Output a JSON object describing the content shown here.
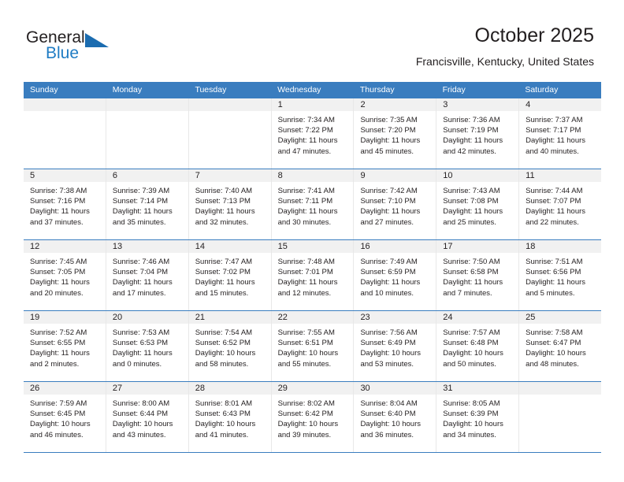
{
  "brand": {
    "name_part1": "General",
    "name_part2": "Blue",
    "accent_color": "#1b6cb0"
  },
  "header": {
    "title": "October 2025",
    "location": "Francisville, Kentucky, United States"
  },
  "theme": {
    "header_row_color": "#3a7dbf",
    "day_band_color": "#f1f1f1",
    "row_separator_color": "#3a7dbf",
    "text_color": "#231f20"
  },
  "weekdays": [
    "Sunday",
    "Monday",
    "Tuesday",
    "Wednesday",
    "Thursday",
    "Friday",
    "Saturday"
  ],
  "labels": {
    "sunrise_prefix": "Sunrise:",
    "sunset_prefix": "Sunset:",
    "daylight_prefix": "Daylight:"
  },
  "weeks": [
    [
      {
        "day": "",
        "empty": true
      },
      {
        "day": "",
        "empty": true
      },
      {
        "day": "",
        "empty": true
      },
      {
        "day": "1",
        "sunrise": "Sunrise: 7:34 AM",
        "sunset": "Sunset: 7:22 PM",
        "daylight": "Daylight: 11 hours and 47 minutes."
      },
      {
        "day": "2",
        "sunrise": "Sunrise: 7:35 AM",
        "sunset": "Sunset: 7:20 PM",
        "daylight": "Daylight: 11 hours and 45 minutes."
      },
      {
        "day": "3",
        "sunrise": "Sunrise: 7:36 AM",
        "sunset": "Sunset: 7:19 PM",
        "daylight": "Daylight: 11 hours and 42 minutes."
      },
      {
        "day": "4",
        "sunrise": "Sunrise: 7:37 AM",
        "sunset": "Sunset: 7:17 PM",
        "daylight": "Daylight: 11 hours and 40 minutes."
      }
    ],
    [
      {
        "day": "5",
        "sunrise": "Sunrise: 7:38 AM",
        "sunset": "Sunset: 7:16 PM",
        "daylight": "Daylight: 11 hours and 37 minutes."
      },
      {
        "day": "6",
        "sunrise": "Sunrise: 7:39 AM",
        "sunset": "Sunset: 7:14 PM",
        "daylight": "Daylight: 11 hours and 35 minutes."
      },
      {
        "day": "7",
        "sunrise": "Sunrise: 7:40 AM",
        "sunset": "Sunset: 7:13 PM",
        "daylight": "Daylight: 11 hours and 32 minutes."
      },
      {
        "day": "8",
        "sunrise": "Sunrise: 7:41 AM",
        "sunset": "Sunset: 7:11 PM",
        "daylight": "Daylight: 11 hours and 30 minutes."
      },
      {
        "day": "9",
        "sunrise": "Sunrise: 7:42 AM",
        "sunset": "Sunset: 7:10 PM",
        "daylight": "Daylight: 11 hours and 27 minutes."
      },
      {
        "day": "10",
        "sunrise": "Sunrise: 7:43 AM",
        "sunset": "Sunset: 7:08 PM",
        "daylight": "Daylight: 11 hours and 25 minutes."
      },
      {
        "day": "11",
        "sunrise": "Sunrise: 7:44 AM",
        "sunset": "Sunset: 7:07 PM",
        "daylight": "Daylight: 11 hours and 22 minutes."
      }
    ],
    [
      {
        "day": "12",
        "sunrise": "Sunrise: 7:45 AM",
        "sunset": "Sunset: 7:05 PM",
        "daylight": "Daylight: 11 hours and 20 minutes."
      },
      {
        "day": "13",
        "sunrise": "Sunrise: 7:46 AM",
        "sunset": "Sunset: 7:04 PM",
        "daylight": "Daylight: 11 hours and 17 minutes."
      },
      {
        "day": "14",
        "sunrise": "Sunrise: 7:47 AM",
        "sunset": "Sunset: 7:02 PM",
        "daylight": "Daylight: 11 hours and 15 minutes."
      },
      {
        "day": "15",
        "sunrise": "Sunrise: 7:48 AM",
        "sunset": "Sunset: 7:01 PM",
        "daylight": "Daylight: 11 hours and 12 minutes."
      },
      {
        "day": "16",
        "sunrise": "Sunrise: 7:49 AM",
        "sunset": "Sunset: 6:59 PM",
        "daylight": "Daylight: 11 hours and 10 minutes."
      },
      {
        "day": "17",
        "sunrise": "Sunrise: 7:50 AM",
        "sunset": "Sunset: 6:58 PM",
        "daylight": "Daylight: 11 hours and 7 minutes."
      },
      {
        "day": "18",
        "sunrise": "Sunrise: 7:51 AM",
        "sunset": "Sunset: 6:56 PM",
        "daylight": "Daylight: 11 hours and 5 minutes."
      }
    ],
    [
      {
        "day": "19",
        "sunrise": "Sunrise: 7:52 AM",
        "sunset": "Sunset: 6:55 PM",
        "daylight": "Daylight: 11 hours and 2 minutes."
      },
      {
        "day": "20",
        "sunrise": "Sunrise: 7:53 AM",
        "sunset": "Sunset: 6:53 PM",
        "daylight": "Daylight: 11 hours and 0 minutes."
      },
      {
        "day": "21",
        "sunrise": "Sunrise: 7:54 AM",
        "sunset": "Sunset: 6:52 PM",
        "daylight": "Daylight: 10 hours and 58 minutes."
      },
      {
        "day": "22",
        "sunrise": "Sunrise: 7:55 AM",
        "sunset": "Sunset: 6:51 PM",
        "daylight": "Daylight: 10 hours and 55 minutes."
      },
      {
        "day": "23",
        "sunrise": "Sunrise: 7:56 AM",
        "sunset": "Sunset: 6:49 PM",
        "daylight": "Daylight: 10 hours and 53 minutes."
      },
      {
        "day": "24",
        "sunrise": "Sunrise: 7:57 AM",
        "sunset": "Sunset: 6:48 PM",
        "daylight": "Daylight: 10 hours and 50 minutes."
      },
      {
        "day": "25",
        "sunrise": "Sunrise: 7:58 AM",
        "sunset": "Sunset: 6:47 PM",
        "daylight": "Daylight: 10 hours and 48 minutes."
      }
    ],
    [
      {
        "day": "26",
        "sunrise": "Sunrise: 7:59 AM",
        "sunset": "Sunset: 6:45 PM",
        "daylight": "Daylight: 10 hours and 46 minutes."
      },
      {
        "day": "27",
        "sunrise": "Sunrise: 8:00 AM",
        "sunset": "Sunset: 6:44 PM",
        "daylight": "Daylight: 10 hours and 43 minutes."
      },
      {
        "day": "28",
        "sunrise": "Sunrise: 8:01 AM",
        "sunset": "Sunset: 6:43 PM",
        "daylight": "Daylight: 10 hours and 41 minutes."
      },
      {
        "day": "29",
        "sunrise": "Sunrise: 8:02 AM",
        "sunset": "Sunset: 6:42 PM",
        "daylight": "Daylight: 10 hours and 39 minutes."
      },
      {
        "day": "30",
        "sunrise": "Sunrise: 8:04 AM",
        "sunset": "Sunset: 6:40 PM",
        "daylight": "Daylight: 10 hours and 36 minutes."
      },
      {
        "day": "31",
        "sunrise": "Sunrise: 8:05 AM",
        "sunset": "Sunset: 6:39 PM",
        "daylight": "Daylight: 10 hours and 34 minutes."
      },
      {
        "day": "",
        "empty": true
      }
    ]
  ]
}
